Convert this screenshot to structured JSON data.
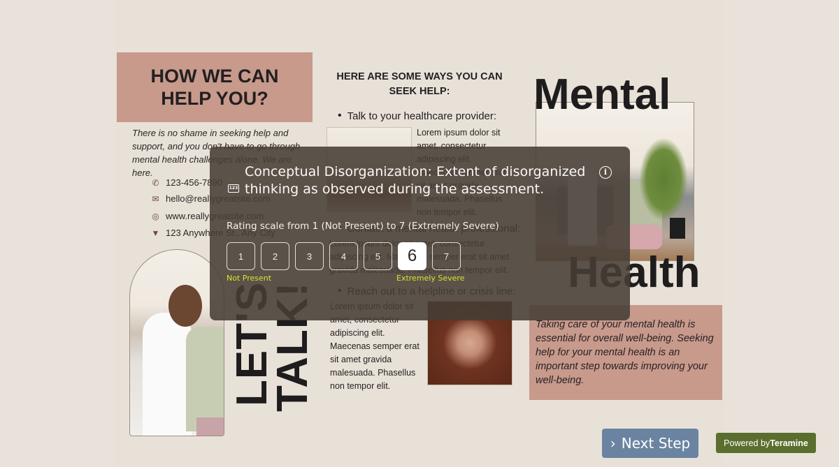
{
  "poster": {
    "how_title": "HOW WE CAN HELP YOU?",
    "shame_text": "There is no shame in seeking help and support, and you don't have to go through mental health challenges alone. We are here.",
    "contacts": [
      {
        "icon": "phone-icon",
        "glyph": "✆",
        "text": "123-456-7890"
      },
      {
        "icon": "mail-icon",
        "glyph": "✉",
        "text": "hello@reallygreatsite.com"
      },
      {
        "icon": "globe-icon",
        "glyph": "◎",
        "text": "www.reallygreatsite.com"
      },
      {
        "icon": "location-pin-icon",
        "glyph": "▼",
        "text": "123 Anywhere St., Any City"
      }
    ],
    "lets": "LET'S",
    "talk": "TALK!",
    "ways_title": "HERE ARE SOME WAYS YOU CAN SEEK HELP:",
    "bullets": [
      "Talk to your healthcare provider:",
      "Contact a mental health professional:",
      "Reach out to a helpline or crisis line:"
    ],
    "lorem_short": "Lorem ipsum dolor sit amet, consectetur adipiscing elit. Maecenas semper erat sit amet gravida malesuada. Phasellus non tempor elit.",
    "lorem_wide": "Lorem ipsum dolor sit amet, consectetur adipiscing elit. Maecenas semper erat sit amet gravida malesuada. Phasellus non tempor elit.",
    "mental": "Mental",
    "health": "Health",
    "care_text": "Taking care of your mental health is essential for overall well-being. Seeking help for your mental health is an important step towards improving your well-being."
  },
  "question": {
    "type_icon": "123",
    "title": "Conceptual Disorganization: Extent of disorganized thinking as observed during the assessment.",
    "scale_text": "Rating scale from 1 (Not Present) to 7 (Extremely Severe)",
    "options": [
      "1",
      "2",
      "3",
      "4",
      "5",
      "6",
      "7"
    ],
    "selected": "6",
    "low_label": "Not Present",
    "high_label": "Extremely Severe"
  },
  "footer": {
    "next_label": "Next Step",
    "powered_prefix": "Powered by",
    "powered_brand": "Teramine"
  },
  "colors": {
    "accent_pink": "#c79a8c",
    "modal_bg": "#473d35",
    "label_yellow": "#dbe32c",
    "next_button": "#6a83a1",
    "powered_badge": "#5a6e2e"
  }
}
